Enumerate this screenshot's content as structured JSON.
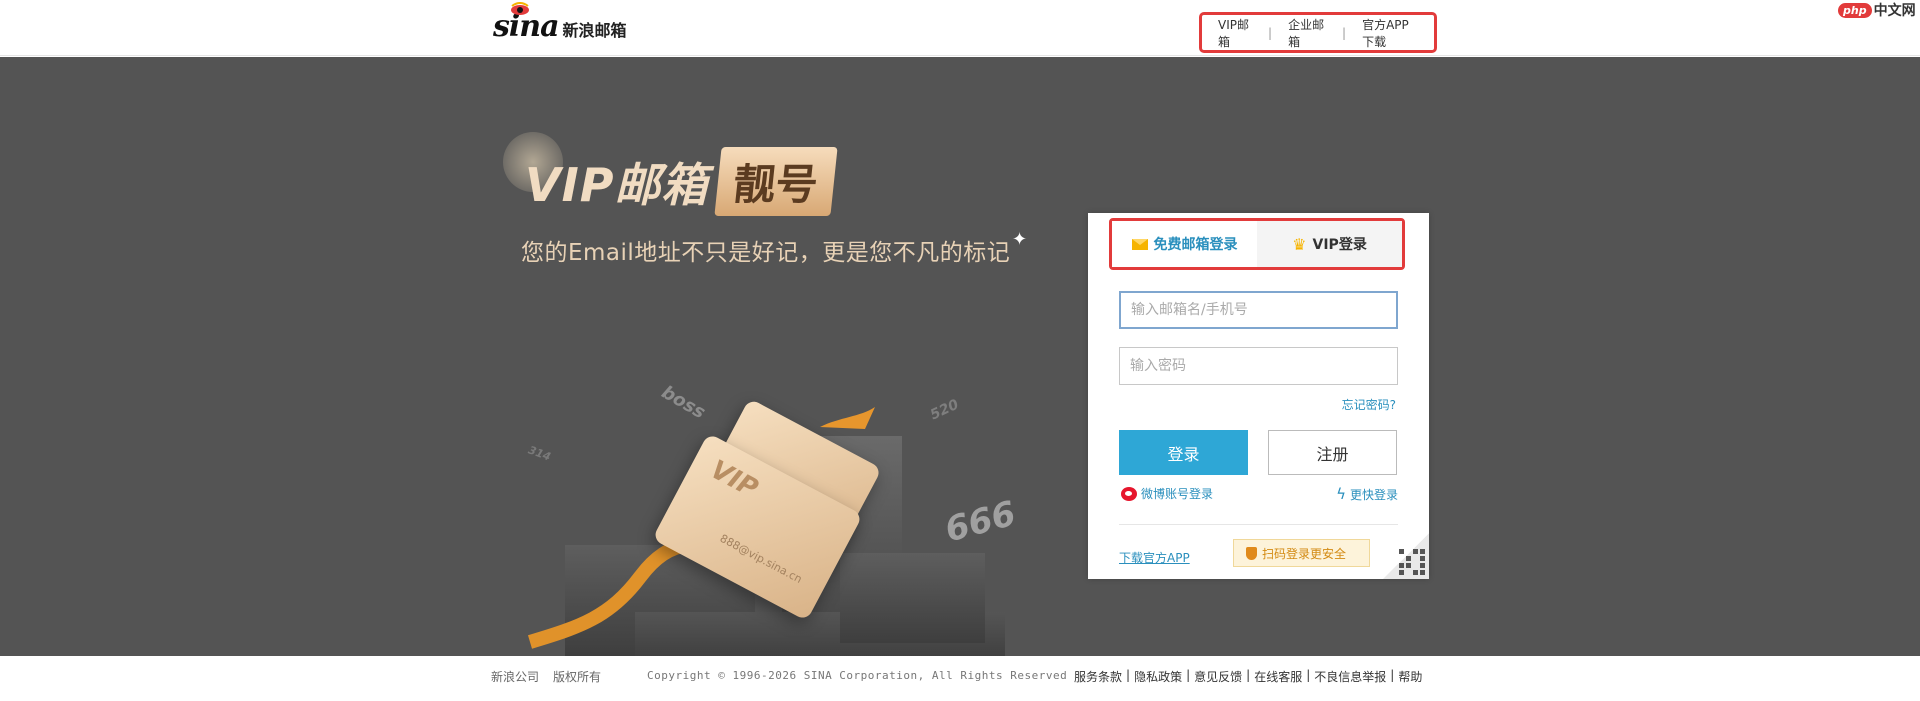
{
  "header": {
    "logo_sina": "sina",
    "logo_text": "新浪邮箱",
    "nav": [
      "VIP邮箱",
      "企业邮箱",
      "官方APP下载"
    ],
    "nav_separator": "|"
  },
  "watermark": {
    "badge": "php",
    "text": "中文网"
  },
  "promo": {
    "vip_word": "VIP邮箱",
    "badge": "靓号",
    "subtitle": "您的Email地址不只是好记，更是您不凡的标记",
    "card_text": "VIP",
    "card_email": "888@vip.sina.cn",
    "float_tags": [
      "boss",
      "520",
      "666",
      "314"
    ]
  },
  "login": {
    "tab_free": "免费邮箱登录",
    "tab_vip": "VIP登录",
    "username_placeholder": "输入邮箱名/手机号",
    "password_placeholder": "输入密码",
    "forgot": "忘记密码?",
    "login_button": "登录",
    "register_button": "注册",
    "weibo_login": "微博账号登录",
    "quick_login": "更快登录",
    "download_app": "下载官方APP",
    "scan_hint": "扫码登录更安全"
  },
  "footer": {
    "left": [
      "新浪公司",
      "版权所有"
    ],
    "copyright": "Copyright © 1996-2026 SINA Corporation, All Rights Reserved",
    "links": [
      "服务条款",
      "隐私政策",
      "意见反馈",
      "在线客服",
      "不良信息举报",
      "帮助"
    ]
  },
  "colors": {
    "accent": "#2ea7d6",
    "highlight": "#e23b3b",
    "background": "#545454"
  }
}
